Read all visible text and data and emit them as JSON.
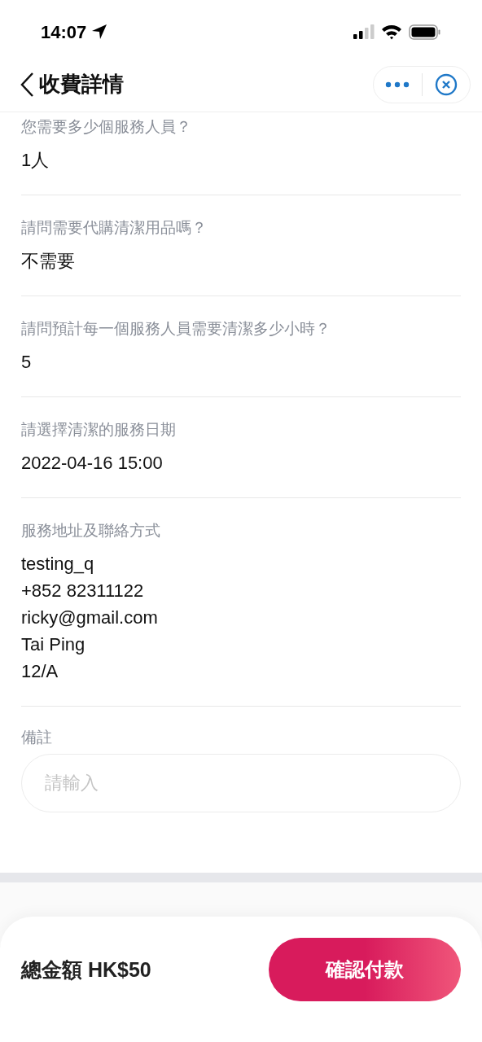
{
  "status_bar": {
    "time": "14:07"
  },
  "nav": {
    "title": "收費詳情"
  },
  "fields": [
    {
      "label": "您需要多少個服務人員？",
      "lines": [
        "1人"
      ]
    },
    {
      "label": "請問需要代購清潔用品嗎？",
      "lines": [
        "不需要"
      ]
    },
    {
      "label": "請問預計每一個服務人員需要清潔多少小時？",
      "lines": [
        "5"
      ]
    },
    {
      "label": "請選擇清潔的服務日期",
      "lines": [
        "2022-04-16 15:00"
      ]
    },
    {
      "label": "服務地址及聯絡方式",
      "lines": [
        "testing_q",
        "+852 82311122",
        "ricky@gmail.com",
        "Tai Ping",
        "12/A"
      ]
    }
  ],
  "remarks": {
    "label": "備註",
    "placeholder": "請輸入"
  },
  "footer": {
    "total": "總金額 HK$50",
    "button": "確認付款"
  }
}
